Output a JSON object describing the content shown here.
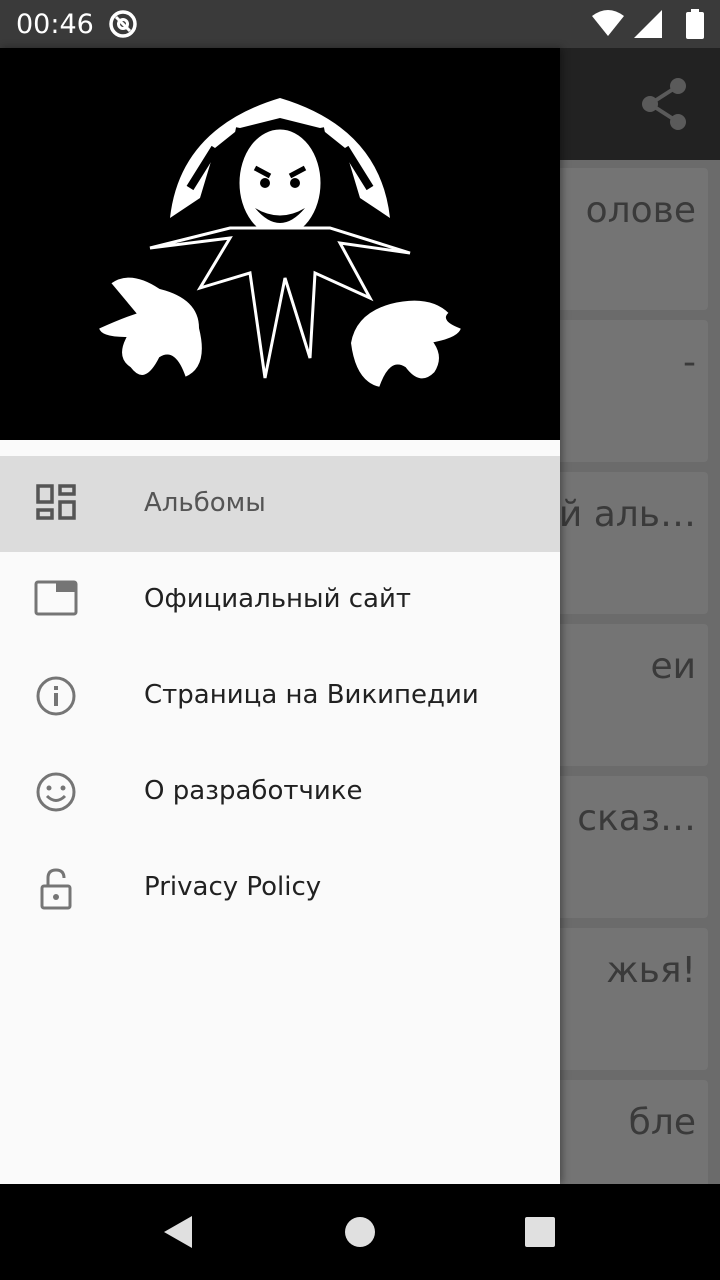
{
  "status_bar": {
    "time": "00:46",
    "icons": [
      "at-sign-notification-icon",
      "wifi-icon",
      "signal-icon",
      "battery-icon"
    ]
  },
  "toolbar": {
    "share_icon": "share-icon"
  },
  "background_cards": [
    "олове",
    "-",
    "й аль…",
    "еи",
    "сказ…",
    "жья!",
    "бле"
  ],
  "drawer": {
    "header_image": "jester-logo",
    "items": [
      {
        "label": "Альбомы",
        "icon": "dashboard-icon",
        "active": true
      },
      {
        "label": "Официальный сайт",
        "icon": "browser-window-icon",
        "active": false
      },
      {
        "label": "Страница на Википедии",
        "icon": "info-icon",
        "active": false
      },
      {
        "label": "О разработчике",
        "icon": "smiley-icon",
        "active": false
      },
      {
        "label": "Privacy Policy",
        "icon": "unlock-icon",
        "active": false
      }
    ]
  },
  "nav_bar": {
    "icons": [
      "back-icon",
      "home-icon",
      "recents-icon"
    ]
  },
  "colors": {
    "drawer_bg": "#fafafa",
    "active_item_bg": "#dcdcdc",
    "status_bar": "#3a3a3a",
    "toolbar": "#222222"
  }
}
